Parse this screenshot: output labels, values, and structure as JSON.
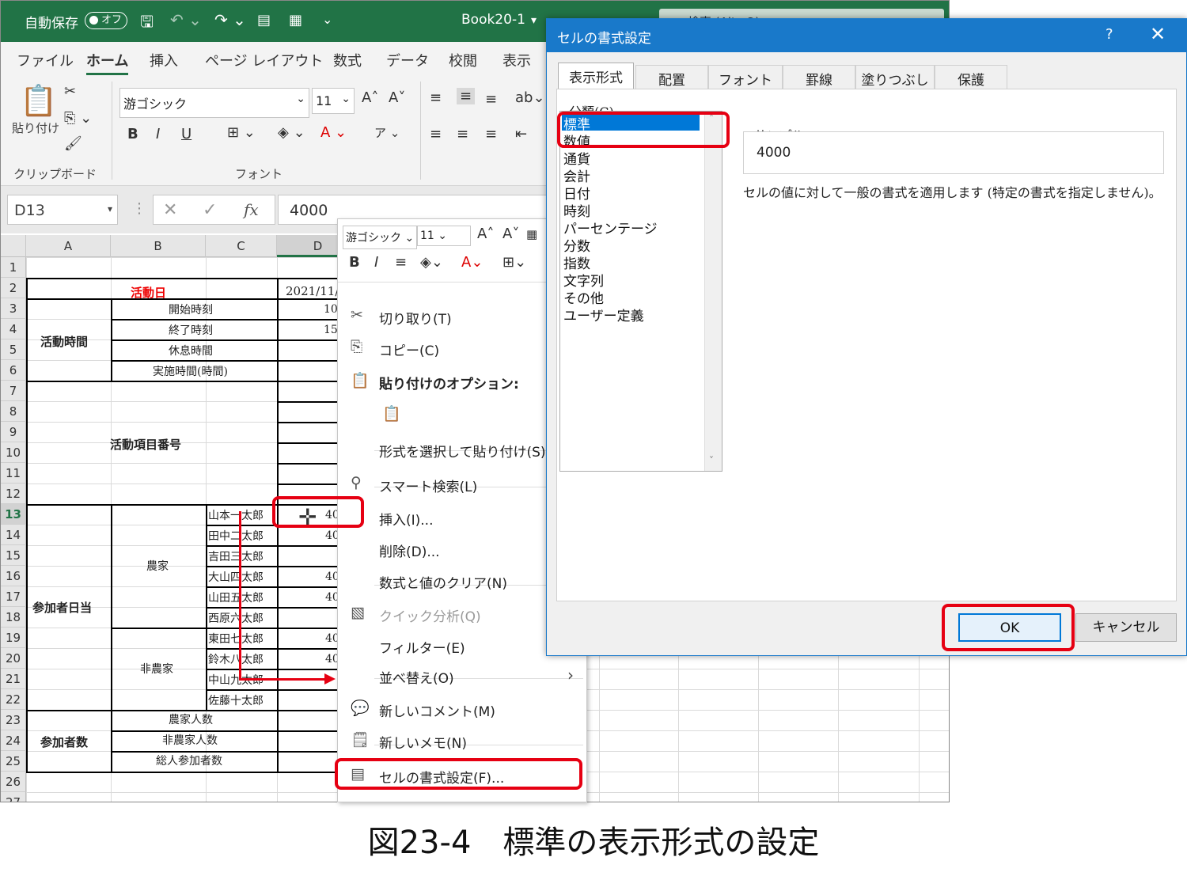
{
  "excel": {
    "autosave_label": "自動保存",
    "autosave_state": "オフ",
    "filename": "Book20-1",
    "search_placeholder": "検索 (Alt+Q)",
    "tabs": [
      "ファイル",
      "ホーム",
      "挿入",
      "ページ レイアウト",
      "数式",
      "データ",
      "校閲",
      "表示"
    ],
    "ribbon": {
      "paste_label": "貼り付け",
      "clipboard_group": "クリップボード",
      "font_name": "游ゴシック",
      "font_size": "11",
      "font_group": "フォント",
      "bold": "B",
      "italic": "I",
      "underline": "U"
    },
    "name_box": "D13",
    "formula_value": "4000",
    "fx_symbol": "fx",
    "column_headers": [
      "A",
      "B",
      "C",
      "D"
    ],
    "row_headers": [
      "1",
      "2",
      "3",
      "4",
      "5",
      "6",
      "7",
      "8",
      "9",
      "10",
      "11",
      "12",
      "13",
      "14",
      "15",
      "16",
      "17",
      "18",
      "19",
      "20",
      "21",
      "22",
      "23",
      "24",
      "25",
      "26",
      "27"
    ],
    "cells": {
      "activity_date_label": "活動日",
      "activity_date_value": "2021/11/11",
      "activity_time_label": "活動時間",
      "start_time": "開始時刻",
      "end_time": "終了時刻",
      "break_time": "休息時間",
      "actual_hours": "実施時間(時間)",
      "activity_item_label": "活動項目番号",
      "participant_daily": "参加者日当",
      "farmer": "農家",
      "non_farmer": "非農家",
      "participants_count": "参加者数",
      "farmer_count": "農家人数",
      "non_farmer_count": "非農家人数",
      "total_count": "総人参加者数",
      "names": [
        "山本一太郎",
        "田中二太郎",
        "吉田三太郎",
        "大山四太郎",
        "山田五太郎",
        "西原六太郎",
        "東田七太郎",
        "鈴木八太郎",
        "中山九太郎",
        "佐藤十太郎"
      ],
      "d3": "10",
      "d4": "15",
      "d13": "40",
      "d14": "40",
      "d16": "40",
      "d17": "40",
      "d19": "40",
      "d20": "40"
    }
  },
  "context_menu": {
    "mini_font": "游ゴシック",
    "mini_size": "11",
    "items": [
      {
        "icon": "scissors-icon",
        "label": "切り取り(T)"
      },
      {
        "icon": "copy-icon",
        "label": "コピー(C)"
      },
      {
        "icon": "paste-icon",
        "label": "貼り付けのオプション:"
      },
      {
        "icon": "paste-option-icon",
        "label": ""
      },
      {
        "icon": "",
        "label": "形式を選択して貼り付け(S)..."
      },
      {
        "icon": "smart-search-icon",
        "label": "スマート検索(L)"
      },
      {
        "icon": "",
        "label": "挿入(I)..."
      },
      {
        "icon": "",
        "label": "削除(D)..."
      },
      {
        "icon": "",
        "label": "数式と値のクリア(N)"
      },
      {
        "icon": "quick-analysis-icon",
        "label": "クイック分析(Q)"
      },
      {
        "icon": "",
        "label": "フィルター(E)"
      },
      {
        "icon": "",
        "label": "並べ替え(O)"
      },
      {
        "icon": "new-comment-icon",
        "label": "新しいコメント(M)"
      },
      {
        "icon": "new-note-icon",
        "label": "新しいメモ(N)"
      },
      {
        "icon": "format-cells-icon",
        "label": "セルの書式設定(F)..."
      }
    ]
  },
  "dialog": {
    "title": "セルの書式設定",
    "help": "?",
    "tabs": [
      "表示形式",
      "配置",
      "フォント",
      "罫線",
      "塗りつぶし",
      "保護"
    ],
    "category_label": "分類(C):",
    "categories": [
      "標準",
      "数値",
      "通貨",
      "会計",
      "日付",
      "時刻",
      "パーセンテージ",
      "分数",
      "指数",
      "文字列",
      "その他",
      "ユーザー定義"
    ],
    "sample_label": "サンプル",
    "sample_value": "4000",
    "description": "セルの値に対して一般の書式を適用します (特定の書式を指定しません)。",
    "ok_label": "OK",
    "cancel_label": "キャンセル"
  },
  "caption": "図23-4　標準の表示形式の設定",
  "colors": {
    "excel_green": "#217346",
    "dialog_blue": "#1979ca",
    "highlight_red": "#e60012",
    "selection_blue": "#0078d7"
  }
}
